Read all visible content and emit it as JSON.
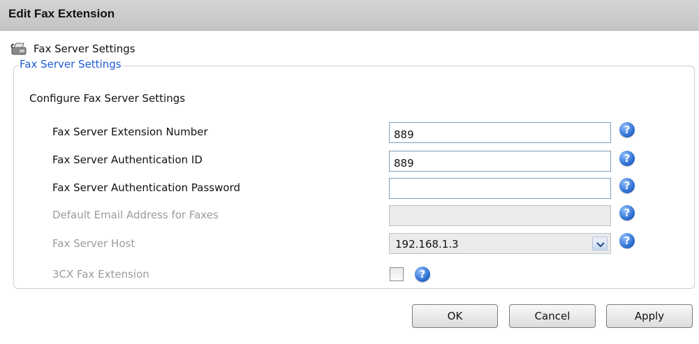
{
  "dialog": {
    "title": "Edit Fax Extension"
  },
  "section": {
    "title": "Fax Server Settings",
    "icon": "fax-icon"
  },
  "fieldset": {
    "legend": "Fax Server Settings",
    "group_title": "Configure Fax Server Settings"
  },
  "fields": [
    {
      "label": "Fax Server Extension Number",
      "value": "889",
      "enabled": true
    },
    {
      "label": "Fax Server Authentication ID",
      "value": "889",
      "enabled": true
    },
    {
      "label": "Fax Server Authentication Password",
      "value": "",
      "enabled": true
    },
    {
      "label": "Default Email Address for Faxes",
      "value": "",
      "enabled": false
    },
    {
      "label": "Fax Server Host",
      "value": "192.168.1.3",
      "enabled": false,
      "type": "select"
    },
    {
      "label": "3CX Fax Extension",
      "checked": false,
      "enabled": false,
      "type": "checkbox"
    }
  ],
  "help": {
    "icon": "help-icon",
    "glyph": "?"
  },
  "buttons": {
    "ok": "OK",
    "cancel": "Cancel",
    "apply": "Apply"
  },
  "colors": {
    "legend": "#1d5bd6",
    "help": "#2a6cd0",
    "titlebar": "#c8c8c8"
  }
}
